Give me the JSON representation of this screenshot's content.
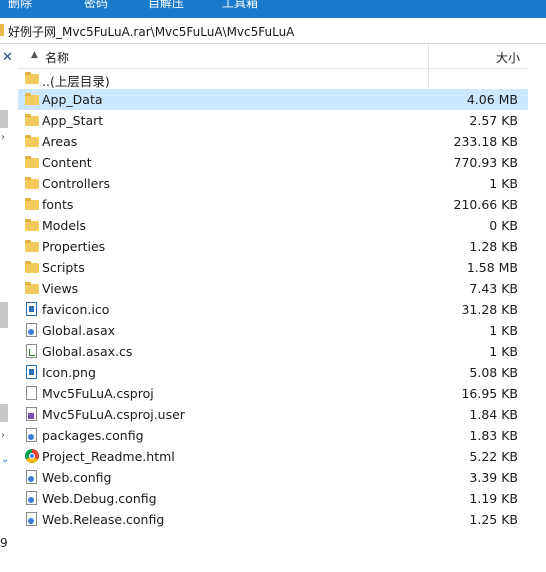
{
  "toolbar": {
    "items": [
      "删除",
      "密码",
      "自解压",
      "工具箱"
    ]
  },
  "address": {
    "path": "好例子网_Mvc5FuLuA.rar\\Mvc5FuLuA\\Mvc5FuLuA"
  },
  "nav": {
    "close_glyph": "✕",
    "bottom_num": "9"
  },
  "header": {
    "name_label": "名称",
    "size_label": "大小",
    "sort_glyph": "▲"
  },
  "rows": [
    {
      "name": "..(上层目录)",
      "size": "",
      "icon": "folder-icon",
      "type": "folder"
    },
    {
      "name": "App_Data",
      "size": "4.06 MB",
      "icon": "folder-icon",
      "type": "folder"
    },
    {
      "name": "App_Start",
      "size": "2.57 KB",
      "icon": "folder-icon",
      "type": "folder"
    },
    {
      "name": "Areas",
      "size": "233.18 KB",
      "icon": "folder-icon",
      "type": "folder"
    },
    {
      "name": "Content",
      "size": "770.93 KB",
      "icon": "folder-icon",
      "type": "folder"
    },
    {
      "name": "Controllers",
      "size": "1 KB",
      "icon": "folder-icon",
      "type": "folder"
    },
    {
      "name": "fonts",
      "size": "210.66 KB",
      "icon": "folder-icon",
      "type": "folder"
    },
    {
      "name": "Models",
      "size": "0 KB",
      "icon": "folder-icon",
      "type": "folder"
    },
    {
      "name": "Properties",
      "size": "1.28 KB",
      "icon": "folder-icon",
      "type": "folder"
    },
    {
      "name": "Scripts",
      "size": "1.58 MB",
      "icon": "folder-icon",
      "type": "folder"
    },
    {
      "name": "Views",
      "size": "7.43 KB",
      "icon": "folder-icon",
      "type": "folder"
    },
    {
      "name": "favicon.ico",
      "size": "31.28 KB",
      "icon": "image-file-icon",
      "type": "blue"
    },
    {
      "name": "Global.asax",
      "size": "1 KB",
      "icon": "asax-file-icon",
      "type": "cfg"
    },
    {
      "name": "Global.asax.cs",
      "size": "1 KB",
      "icon": "cs-file-icon",
      "type": "cs"
    },
    {
      "name": "Icon.png",
      "size": "5.08 KB",
      "icon": "image-file-icon",
      "type": "blue"
    },
    {
      "name": "Mvc5FuLuA.csproj",
      "size": "16.95 KB",
      "icon": "blank-file-icon",
      "type": "doc"
    },
    {
      "name": "Mvc5FuLuA.csproj.user",
      "size": "1.84 KB",
      "icon": "vs-file-icon",
      "type": "vs"
    },
    {
      "name": "packages.config",
      "size": "1.83 KB",
      "icon": "config-file-icon",
      "type": "cfg"
    },
    {
      "name": "Project_Readme.html",
      "size": "5.22 KB",
      "icon": "chrome-icon",
      "type": "chrome"
    },
    {
      "name": "Web.config",
      "size": "3.39 KB",
      "icon": "config-file-icon",
      "type": "cfg"
    },
    {
      "name": "Web.Debug.config",
      "size": "1.19 KB",
      "icon": "config-file-icon",
      "type": "cfg"
    },
    {
      "name": "Web.Release.config",
      "size": "1.25 KB",
      "icon": "config-file-icon",
      "type": "cfg"
    }
  ],
  "selected_row": "App_Data",
  "colors": {
    "selection": "#cce8ff",
    "folder": "#f4ca5a",
    "toolbar": "#1979ca"
  }
}
